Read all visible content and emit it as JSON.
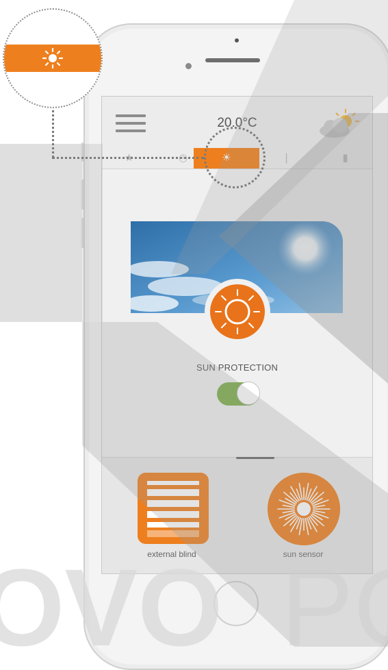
{
  "header": {
    "temperature": "20.0°C",
    "menu_icon": "hamburger-menu-icon",
    "weather_icon": "partly-sunny-icon"
  },
  "tabs": [
    {
      "icon": "star-icon",
      "glyph": "★"
    },
    {
      "icon": "clock-icon",
      "glyph": "◷"
    },
    {
      "icon": "sun-icon",
      "glyph": "☀",
      "active": true
    },
    {
      "icon": "thermometer-icon",
      "glyph": "🌡"
    },
    {
      "icon": "document-icon",
      "glyph": "▮"
    }
  ],
  "sun_protection": {
    "title": "SUN PROTECTION",
    "toggle_on": true,
    "toggle_color": "#7cad4a"
  },
  "devices": [
    {
      "label": "external blind",
      "icon": "external-blind-icon"
    },
    {
      "label": "sun sensor",
      "icon": "sun-sensor-icon"
    }
  ],
  "callout": {
    "icon": "sun-icon",
    "glyph": "☀"
  },
  "colors": {
    "accent": "#ee7f1e",
    "accent_dark": "#e8731a",
    "toggle_green": "#7cad4a"
  },
  "watermark_text": "OVO"
}
